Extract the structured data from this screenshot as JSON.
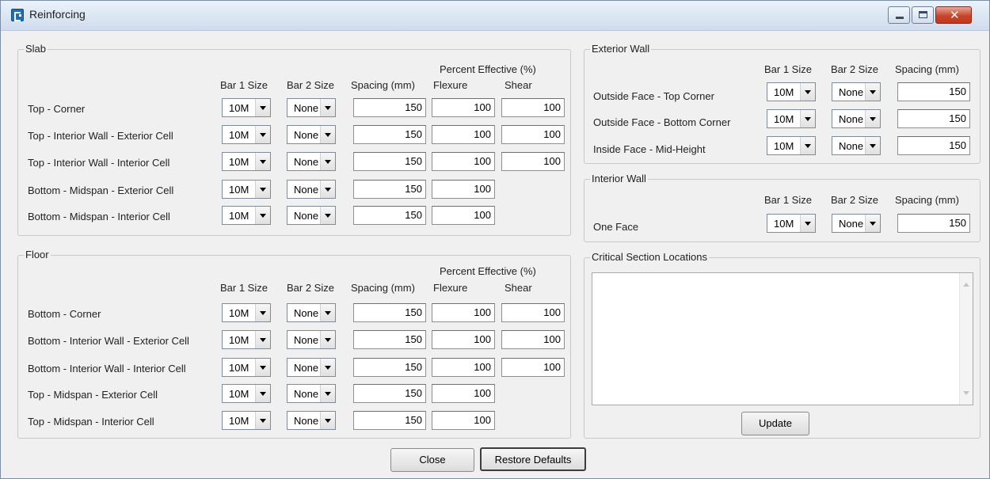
{
  "window": {
    "title": "Reinforcing"
  },
  "headers": {
    "percent_effective": "Percent Effective (%)",
    "bar1": "Bar 1 Size",
    "bar2": "Bar 2 Size",
    "spacing": "Spacing (mm)",
    "flexure": "Flexure",
    "shear": "Shear"
  },
  "slab": {
    "title": "Slab",
    "rows": [
      {
        "label": "Top - Corner",
        "bar1": "10M",
        "bar2": "None",
        "spacing": "150",
        "flexure": "100",
        "shear": "100"
      },
      {
        "label": "Top - Interior Wall - Exterior Cell",
        "bar1": "10M",
        "bar2": "None",
        "spacing": "150",
        "flexure": "100",
        "shear": "100"
      },
      {
        "label": "Top - Interior Wall - Interior Cell",
        "bar1": "10M",
        "bar2": "None",
        "spacing": "150",
        "flexure": "100",
        "shear": "100"
      },
      {
        "label": "Bottom - Midspan - Exterior Cell",
        "bar1": "10M",
        "bar2": "None",
        "spacing": "150",
        "flexure": "100"
      },
      {
        "label": "Bottom - Midspan - Interior Cell",
        "bar1": "10M",
        "bar2": "None",
        "spacing": "150",
        "flexure": "100"
      }
    ]
  },
  "floor": {
    "title": "Floor",
    "rows": [
      {
        "label": "Bottom - Corner",
        "bar1": "10M",
        "bar2": "None",
        "spacing": "150",
        "flexure": "100",
        "shear": "100"
      },
      {
        "label": "Bottom - Interior Wall - Exterior Cell",
        "bar1": "10M",
        "bar2": "None",
        "spacing": "150",
        "flexure": "100",
        "shear": "100"
      },
      {
        "label": "Bottom - Interior Wall - Interior Cell",
        "bar1": "10M",
        "bar2": "None",
        "spacing": "150",
        "flexure": "100",
        "shear": "100"
      },
      {
        "label": "Top - Midspan - Exterior Cell",
        "bar1": "10M",
        "bar2": "None",
        "spacing": "150",
        "flexure": "100"
      },
      {
        "label": "Top - Midspan - Interior Cell",
        "bar1": "10M",
        "bar2": "None",
        "spacing": "150",
        "flexure": "100"
      }
    ]
  },
  "exterior_wall": {
    "title": "Exterior Wall",
    "rows": [
      {
        "label": "Outside Face - Top Corner",
        "bar1": "10M",
        "bar2": "None",
        "spacing": "150"
      },
      {
        "label": "Outside Face - Bottom Corner",
        "bar1": "10M",
        "bar2": "None",
        "spacing": "150"
      },
      {
        "label": "Inside Face - Mid-Height",
        "bar1": "10M",
        "bar2": "None",
        "spacing": "150"
      }
    ]
  },
  "interior_wall": {
    "title": "Interior Wall",
    "rows": [
      {
        "label": "One Face",
        "bar1": "10M",
        "bar2": "None",
        "spacing": "150"
      }
    ]
  },
  "critical_section": {
    "title": "Critical Section Locations",
    "text": "",
    "update_label": "Update"
  },
  "footer": {
    "close_label": "Close",
    "restore_label": "Restore Defaults"
  }
}
